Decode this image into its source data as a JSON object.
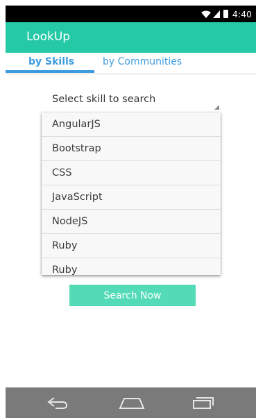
{
  "status_bar": {
    "time": "4:40",
    "icons": [
      "wifi-icon",
      "signal-icon",
      "battery-icon"
    ]
  },
  "app_bar": {
    "title": "LookUp",
    "color": "#25c9a6"
  },
  "tabs": [
    {
      "label": "by Skills",
      "active": true
    },
    {
      "label": "by Communities",
      "active": false
    }
  ],
  "accent_color": "#3d9be0",
  "skill_select": {
    "placeholder": "Select skill to search"
  },
  "dropdown": {
    "options": [
      "AngularJS",
      "Bootstrap",
      "CSS",
      "JavaScript",
      "NodeJS",
      "Ruby",
      "Ruby"
    ]
  },
  "search_button": {
    "label": "Search Now",
    "color": "#52dbb6"
  },
  "nav_bar": {
    "buttons": [
      "back-icon",
      "home-icon",
      "recent-apps-icon"
    ]
  }
}
